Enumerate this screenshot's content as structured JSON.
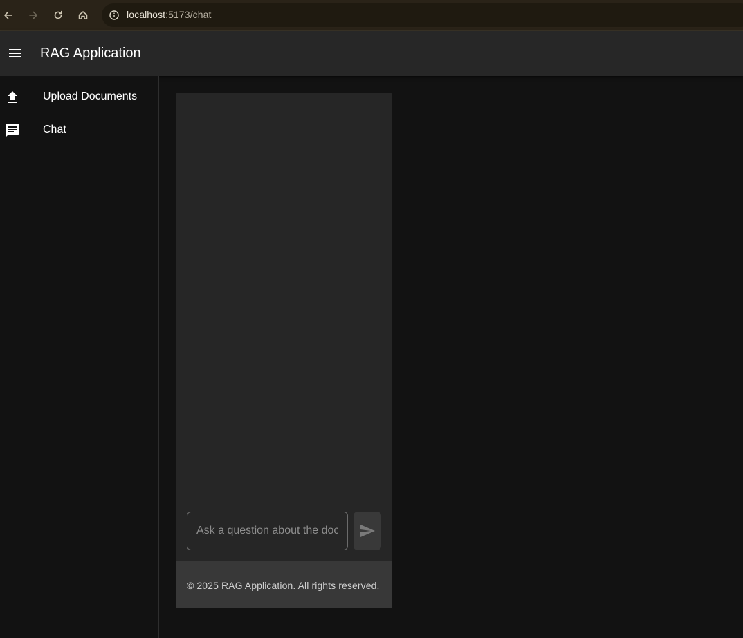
{
  "browser": {
    "url_host": "localhost",
    "url_path": ":5173/chat",
    "icons": [
      "back-icon",
      "forward-icon",
      "reload-icon",
      "home-icon",
      "info-icon"
    ]
  },
  "appbar": {
    "title": "RAG Application",
    "menu_icon": "menu-icon"
  },
  "sidebar": {
    "items": [
      {
        "label": "Upload Documents",
        "icon": "upload-icon"
      },
      {
        "label": "Chat",
        "icon": "chat-icon"
      }
    ]
  },
  "chat": {
    "input_placeholder": "Ask a question about the documents",
    "input_value": "",
    "send_icon": "send-icon"
  },
  "footer": {
    "text": "© 2025 RAG Application. All rights reserved."
  }
}
